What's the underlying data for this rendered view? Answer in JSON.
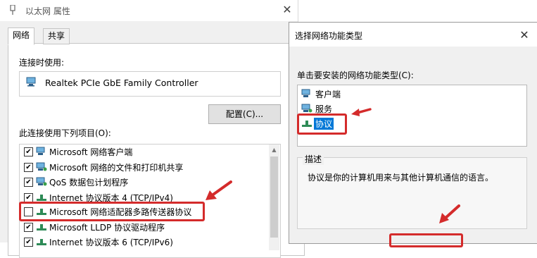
{
  "left_window": {
    "title": "以太网 属性",
    "tabs": [
      "网络",
      "共享"
    ],
    "connect_using_label": "连接时使用:",
    "adapter_name": "Realtek PCIe GbE Family Controller",
    "configure_button": "配置(C)...",
    "items_label": "此连接使用下列项目(O):",
    "items": [
      {
        "checked": true,
        "icon": "client-icon",
        "label": "Microsoft 网络客户端"
      },
      {
        "checked": true,
        "icon": "service-icon",
        "label": "Microsoft 网络的文件和打印机共享"
      },
      {
        "checked": true,
        "icon": "service-icon",
        "label": "QoS 数据包计划程序"
      },
      {
        "checked": true,
        "icon": "protocol-icon",
        "label": "Internet 协议版本 4 (TCP/IPv4)"
      },
      {
        "checked": false,
        "icon": "protocol-icon",
        "label": "Microsoft 网络适配器多路传送器协议"
      },
      {
        "checked": true,
        "icon": "protocol-icon",
        "label": "Microsoft LLDP 协议驱动程序"
      },
      {
        "checked": true,
        "icon": "protocol-icon",
        "label": "Internet 协议版本 6 (TCP/IPv6)"
      }
    ]
  },
  "right_window": {
    "title": "选择网络功能类型",
    "select_label": "单击要安装的网络功能类型(C):",
    "types": [
      {
        "icon": "client-icon",
        "label": "客户端"
      },
      {
        "icon": "service-icon",
        "label": "服务"
      },
      {
        "icon": "protocol-icon",
        "label": "协议",
        "selected": true
      }
    ],
    "description_title": "描述",
    "description_text": "协议是你的计算机用来与其他计算机通信的语言。"
  },
  "colors": {
    "annotation_red": "#d42b2b",
    "selection_blue": "#0078d7"
  }
}
